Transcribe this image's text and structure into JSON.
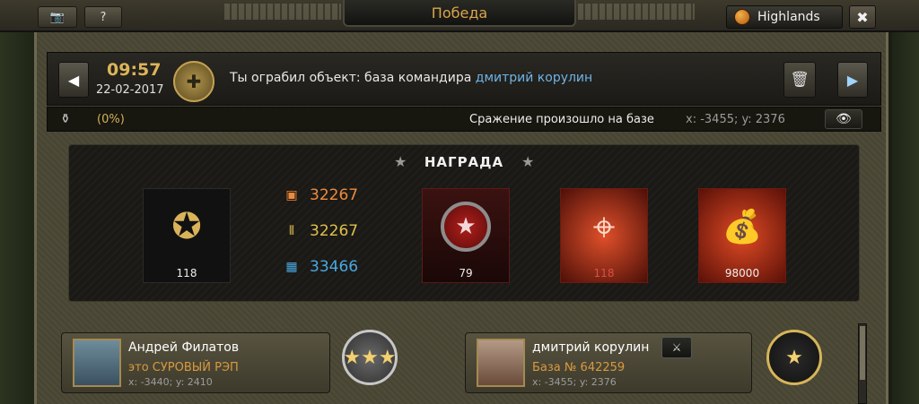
{
  "titlebar": {
    "title": "Победа",
    "server": "Highlands",
    "camera_icon": "camera-icon",
    "help_label": "?",
    "close_label": "✖"
  },
  "info": {
    "time": "09:57",
    "date": "22-02-2017",
    "message_prefix": "Ты ограбил объект: база командира ",
    "message_link": "дмитрий корулин"
  },
  "strip": {
    "percent": "(0%)",
    "battle_text": "Сражение произошло на базе",
    "coords": "x: -3455; y: 2376"
  },
  "reward": {
    "title": "НАГРАДА",
    "resources": [
      {
        "icon": "fuel-icon",
        "value": "32267",
        "color": "#f08a3a"
      },
      {
        "icon": "ammo-icon",
        "value": "32267",
        "color": "#e0c04a"
      },
      {
        "icon": "blocks-icon",
        "value": "33466",
        "color": "#4aa8e0"
      }
    ],
    "tiles": [
      {
        "name": "laurel-star",
        "value": "118",
        "color": "#eeeeee"
      },
      {
        "name": "medal",
        "value": "79",
        "color": "#eeeeee"
      },
      {
        "name": "target",
        "value": "118",
        "color": "#d9504a"
      },
      {
        "name": "money-bags",
        "value": "98000",
        "color": "#eeeeee"
      }
    ]
  },
  "players": {
    "attacker": {
      "name": "Андрей Филатов",
      "subtitle": "это СУРОВЫЙ РЭП",
      "coords": "x: -3440; y: 2410"
    },
    "defender": {
      "name": "дмитрий корулин",
      "subtitle": "База № 642259",
      "coords": "x: -3455; y: 2376"
    }
  }
}
